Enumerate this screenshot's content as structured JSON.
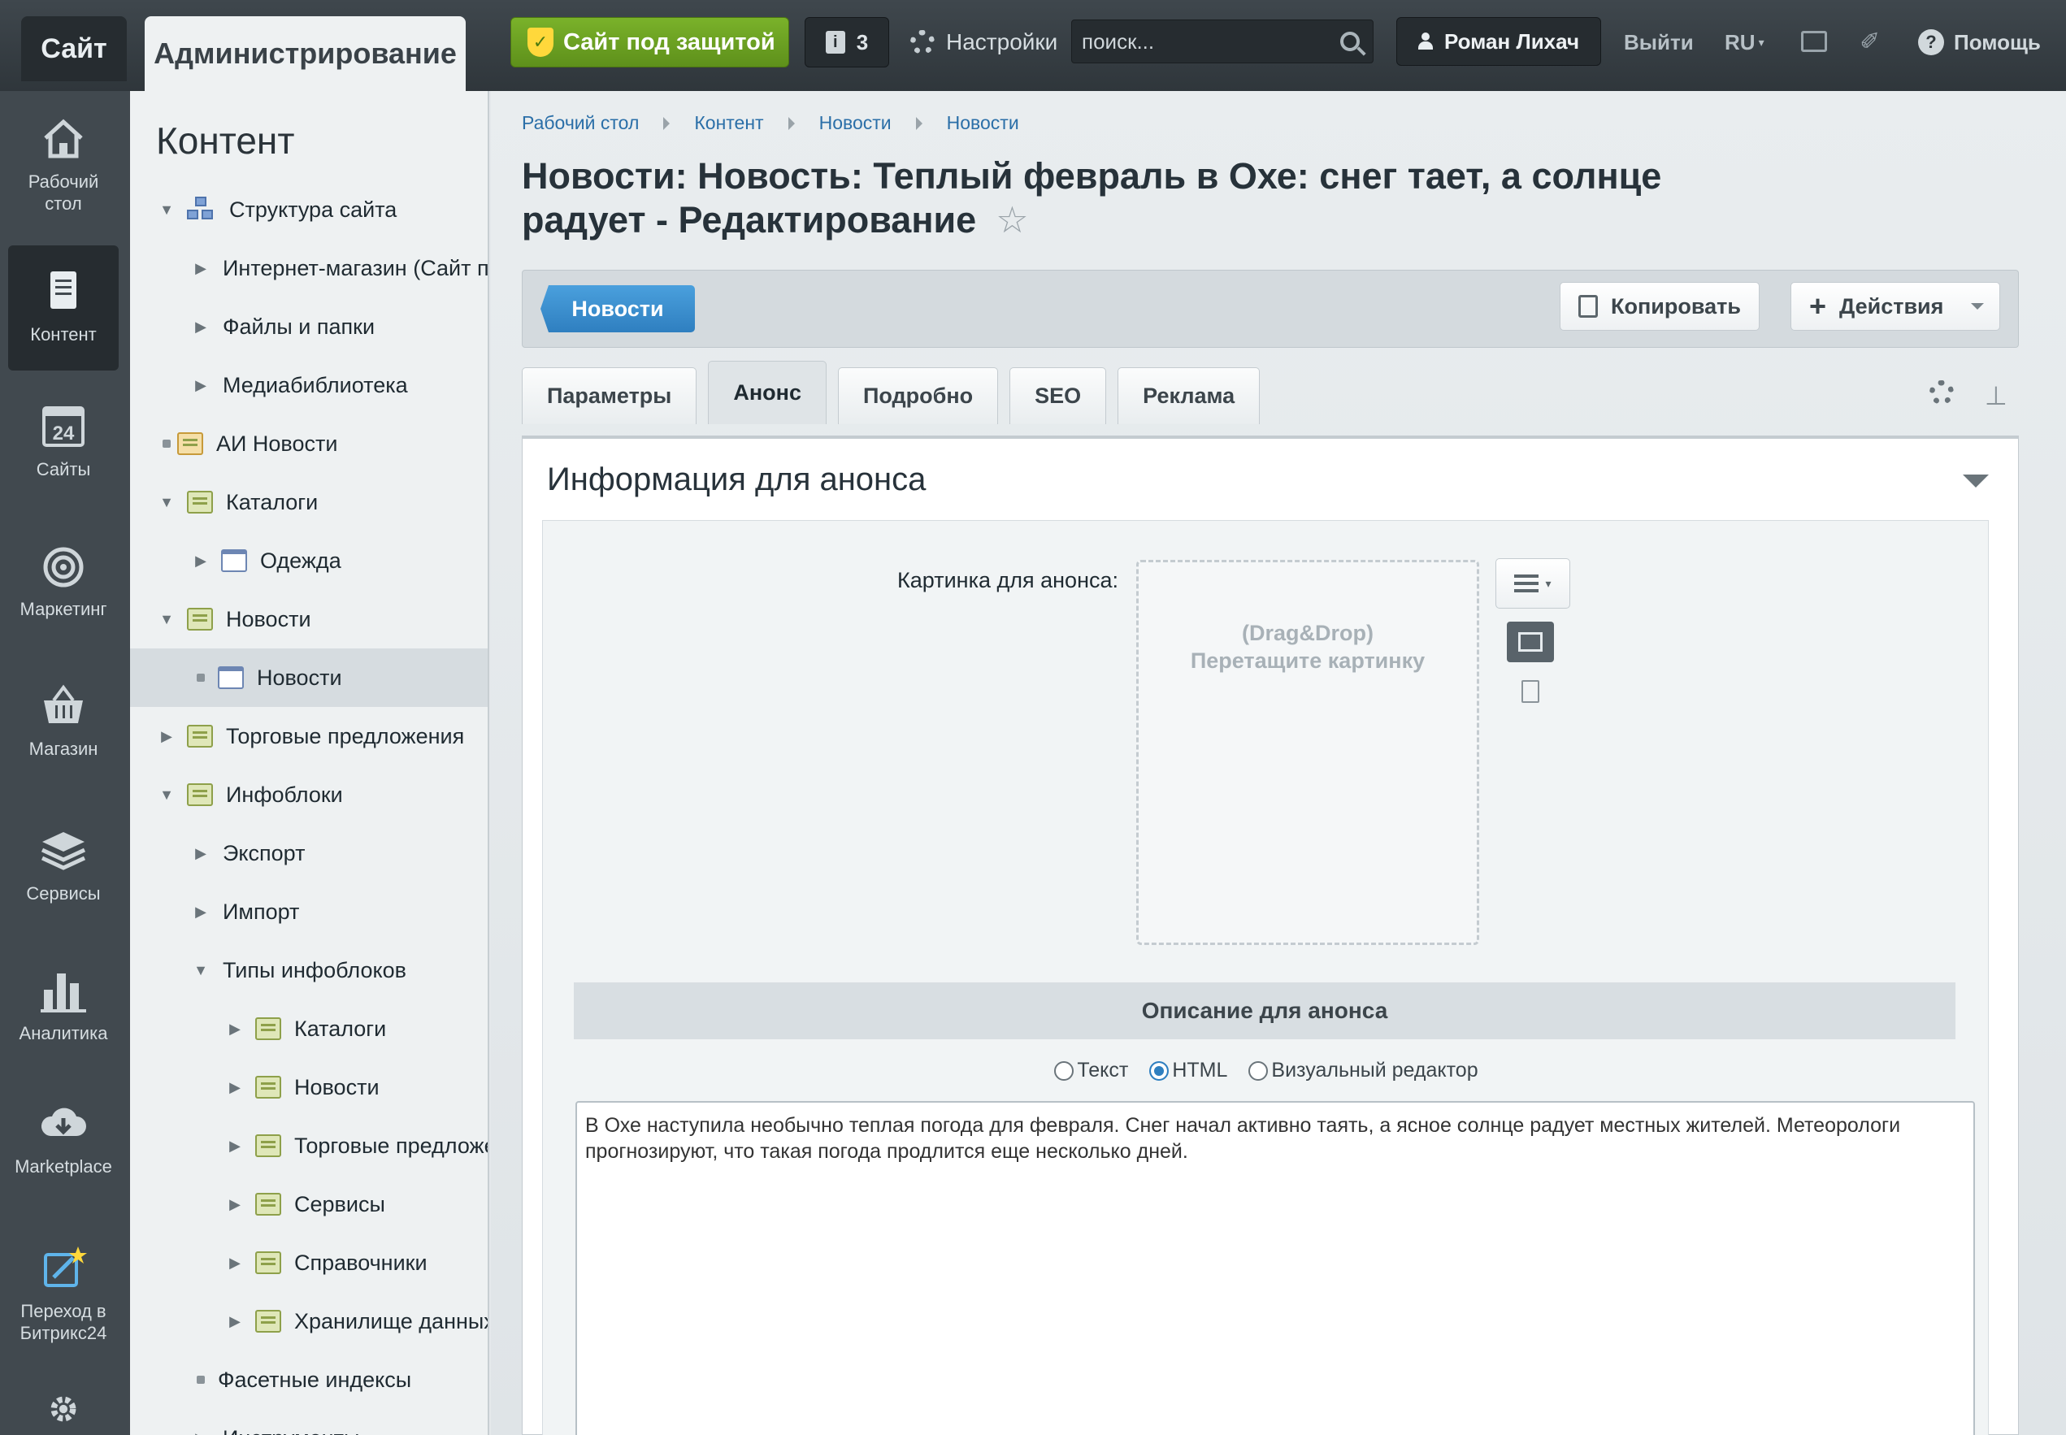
{
  "topbar": {
    "site_label": "Сайт",
    "admin_label": "Администрирование",
    "protect_label": "Сайт под защитой",
    "notifications_count": "3",
    "settings_label": "Настройки",
    "search_placeholder": "поиск...",
    "user_name": "Роман Лихач",
    "logout_label": "Выйти",
    "lang_label": "RU",
    "help_label": "Помощь"
  },
  "rail": {
    "items": [
      {
        "label": "Рабочий стол",
        "icon": "home-icon"
      },
      {
        "label": "Контент",
        "icon": "document-icon",
        "active": true
      },
      {
        "label": "Сайты",
        "icon": "calendar-24-icon"
      },
      {
        "label": "Маркетинг",
        "icon": "target-icon"
      },
      {
        "label": "Магазин",
        "icon": "basket-icon"
      },
      {
        "label": "Сервисы",
        "icon": "layers-icon"
      },
      {
        "label": "Аналитика",
        "icon": "bar-chart-icon"
      },
      {
        "label": "Marketplace",
        "icon": "cloud-download-icon"
      },
      {
        "label": "Переход в Битрикс24",
        "icon": "external-edit-icon"
      }
    ]
  },
  "tree": {
    "title": "Контент",
    "rows": [
      {
        "label": "Структура сайта"
      },
      {
        "label": "Интернет-магазин (Сайт по умолчанию)"
      },
      {
        "label": "Файлы и папки"
      },
      {
        "label": "Медиабиблиотека"
      },
      {
        "label": "АИ Новости"
      },
      {
        "label": "Каталоги"
      },
      {
        "label": "Одежда"
      },
      {
        "label": "Новости"
      },
      {
        "label": "Новости"
      },
      {
        "label": "Торговые предложения"
      },
      {
        "label": "Инфоблоки"
      },
      {
        "label": "Экспорт"
      },
      {
        "label": "Импорт"
      },
      {
        "label": "Типы инфоблоков"
      },
      {
        "label": "Каталоги"
      },
      {
        "label": "Новости"
      },
      {
        "label": "Торговые предложения"
      },
      {
        "label": "Сервисы"
      },
      {
        "label": "Справочники"
      },
      {
        "label": "Хранилище данных"
      },
      {
        "label": "Фасетные индексы"
      },
      {
        "label": "Инструменты"
      }
    ]
  },
  "breadcrumbs": [
    "Рабочий стол",
    "Контент",
    "Новости",
    "Новости"
  ],
  "page_title": "Новости: Новость: Теплый февраль в Охе: снег тает, а солнце радует - Редактирование",
  "toolbar": {
    "back_label": "Новости",
    "copy_label": "Копировать",
    "actions_label": "Действия"
  },
  "tabs": [
    "Параметры",
    "Анонс",
    "Подробно",
    "SEO",
    "Реклама"
  ],
  "panel": {
    "title": "Информация для анонса",
    "image_label": "Картинка для анонса:",
    "dropzone_line1": "(Drag&Drop)",
    "dropzone_line2": "Перетащите картинку",
    "description_header": "Описание для анонса",
    "radio_options": [
      "Текст",
      "HTML",
      "Визуальный редактор"
    ],
    "radio_selected": "HTML",
    "description_text": "В Охе наступила необычно теплая погода для февраля. Снег начал активно таять, а ясное солнце радует местных жителей. Метеорологи прогнозируют, что такая погода продлится еще несколько дней."
  }
}
